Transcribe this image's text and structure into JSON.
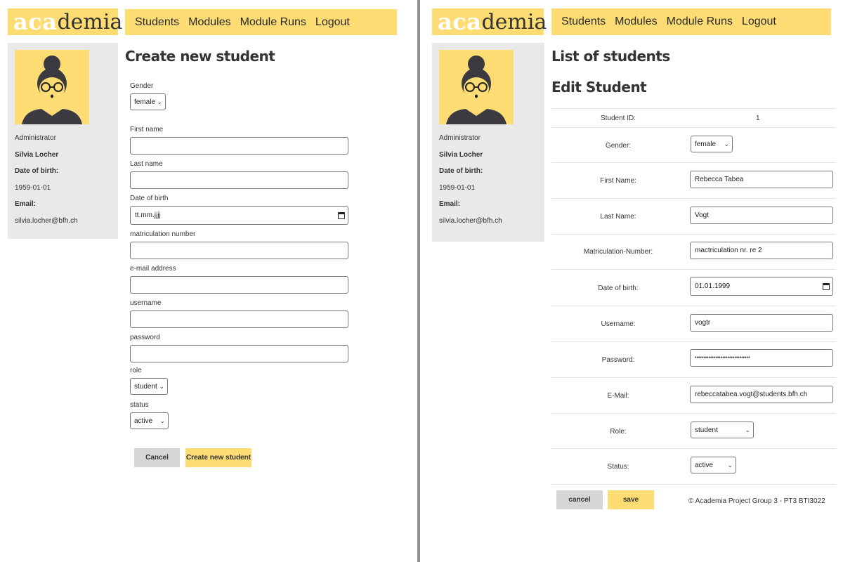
{
  "logo": {
    "part1": "aca",
    "part2": "demia"
  },
  "nav": [
    "Students",
    "Modules",
    "Module Runs",
    "Logout"
  ],
  "profile": {
    "role": "Administrator",
    "name": "Silvia Locher",
    "dob_label": "Date of birth:",
    "dob": "1959-01-01",
    "email_label": "Email:",
    "email": "silvia.locher@bfh.ch"
  },
  "create_form": {
    "title": "Create new student",
    "gender_label": "Gender",
    "gender_value": "female",
    "first_name_label": "First name",
    "last_name_label": "Last name",
    "dob_label": "Date of birth",
    "dob_placeholder": "tt.mm.jjjj",
    "matric_label": "matriculation number",
    "email_label": "e-mail address",
    "username_label": "username",
    "password_label": "password",
    "role_label": "role",
    "role_value": "student",
    "status_label": "status",
    "status_value": "active",
    "cancel_label": "Cancel",
    "submit_label": "Create new student"
  },
  "edit_form": {
    "list_title": "List of students",
    "title": "Edit Student",
    "student_id_label": "Student ID:",
    "student_id": "1",
    "gender_label": "Gender:",
    "gender_value": "female",
    "first_name_label": "First Name:",
    "first_name": "Rebecca Tabea",
    "last_name_label": "Last Name:",
    "last_name": "Vogt",
    "matric_label": "Matriculation-Number:",
    "matric": "mactriculation nr. re 2",
    "dob_label": "Date of birth:",
    "dob": "01.01.1999",
    "username_label": "Username:",
    "username": "vogtr",
    "password_label": "Password:",
    "password": "••••••••••••••••••••••••••••••••",
    "email_label": "E-Mail:",
    "email": "rebeccatabea.vogt@students.bfh.ch",
    "role_label": "Role:",
    "role_value": "student",
    "status_label": "Status:",
    "status_value": "active",
    "cancel_label": "cancel",
    "save_label": "save",
    "footer": "© Academia Project Group 3 - PT3 BTI3022"
  },
  "icons": {
    "chevron": "chevron-down-icon",
    "calendar": "calendar-icon",
    "avatar": "avatar-woman-icon"
  },
  "colors": {
    "accent": "#fcdc73",
    "sidebar": "#e9e9e9",
    "button_gray": "#d6d6d6"
  }
}
